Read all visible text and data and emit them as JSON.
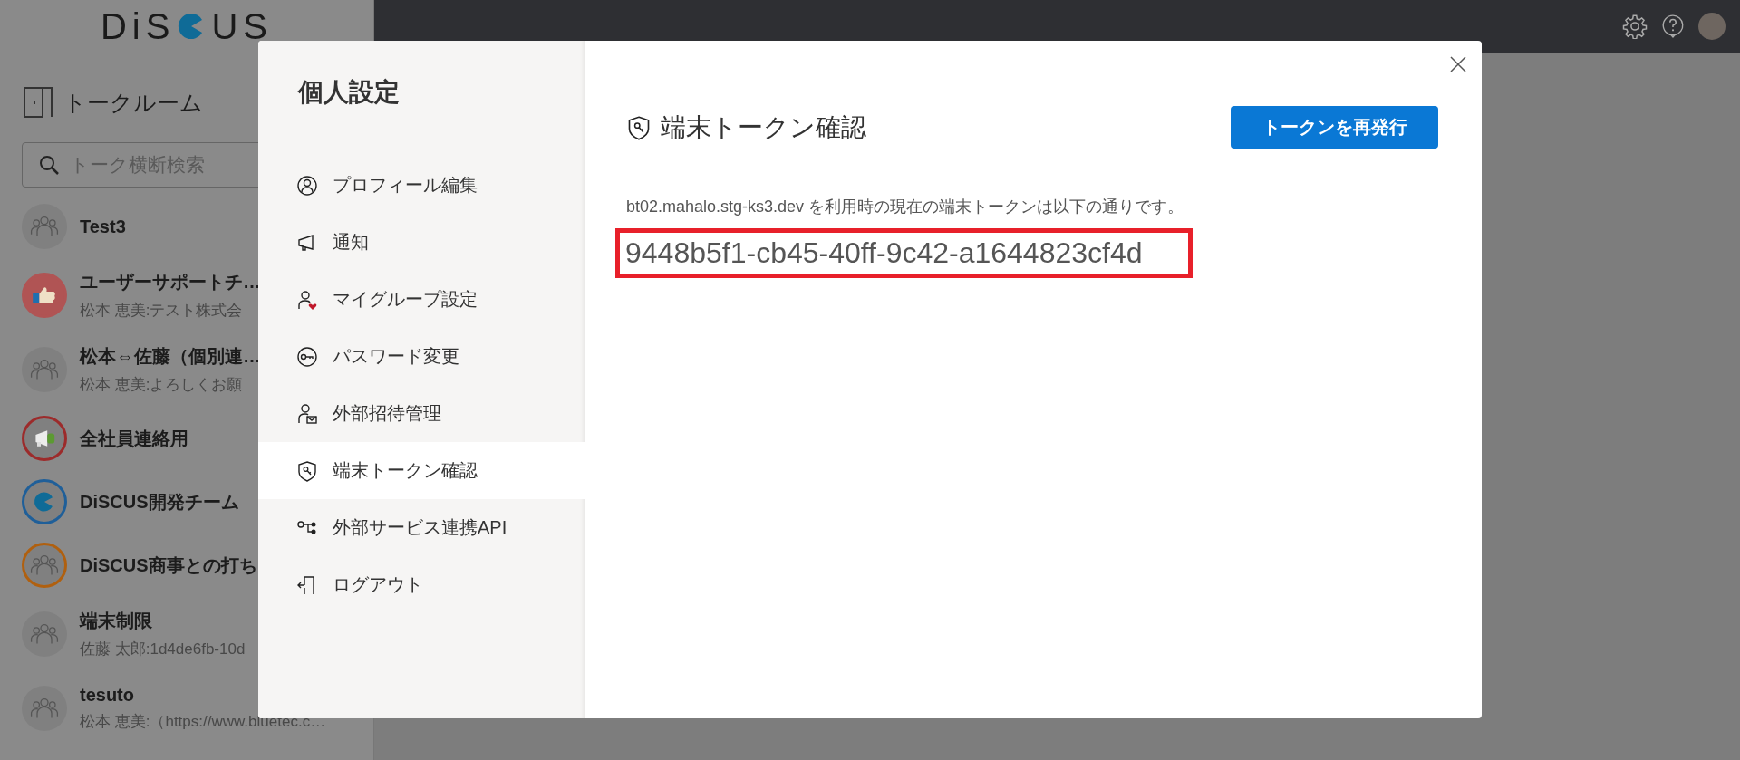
{
  "sidebar": {
    "logo": {
      "text_before": "DiS",
      "text_after": "US"
    },
    "section_title": "トークルーム",
    "search": {
      "placeholder": "トーク横断検索"
    },
    "rooms": [
      {
        "name": "Test3",
        "kind": "group"
      },
      {
        "name": "ユーザーサポートチ…",
        "subtitle": "松本 恵美:テスト株式会",
        "kind": "thumb",
        "color": "#b05454"
      },
      {
        "name": "松本⇔佐藤（個別連…",
        "subtitle": "松本 恵美:よろしくお願",
        "kind": "group"
      },
      {
        "name": "全社員連絡用",
        "kind": "megaphone",
        "color": "#9c2b2b"
      },
      {
        "name": "DiSCUS開発チーム",
        "kind": "logo",
        "color": "#1f5f99"
      },
      {
        "name": "DiSCUS商事との打ち",
        "kind": "group",
        "color": "#b0600f"
      },
      {
        "name": "端末制限",
        "subtitle": "佐藤 太郎:1d4de6fb-10d",
        "kind": "group"
      },
      {
        "name": "tesuto",
        "subtitle": "松本 恵美:（https://www.bluetec.c…",
        "kind": "group"
      }
    ]
  },
  "modal": {
    "title": "個人設定",
    "menu": [
      {
        "label": "プロフィール編集",
        "kind": "profile",
        "selected": false
      },
      {
        "label": "通知",
        "kind": "megaphone",
        "selected": false
      },
      {
        "label": "マイグループ設定",
        "kind": "person-heart",
        "selected": false
      },
      {
        "label": "パスワード変更",
        "kind": "key",
        "selected": false
      },
      {
        "label": "外部招待管理",
        "kind": "person-mail",
        "selected": false
      },
      {
        "label": "端末トークン確認",
        "kind": "shield",
        "selected": true
      },
      {
        "label": "外部サービス連携API",
        "kind": "nodes",
        "selected": false
      },
      {
        "label": "ログアウト",
        "kind": "logout",
        "selected": false
      }
    ],
    "heading": "端末トークン確認",
    "button": "トークンを再発行",
    "description": "bt02.mahalo.stg-ks3.dev を利用時の現在の端末トークンは以下の通りです。",
    "token": "9448b5f1-cb45-40ff-9c42-a1644823cf4d",
    "token_highlighted": true
  }
}
